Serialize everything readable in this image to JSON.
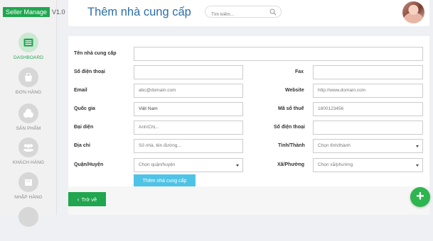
{
  "app": {
    "brand": "Seller Manage",
    "version": "V1.0"
  },
  "header": {
    "title": "Thêm nhà cung cấp",
    "search_placeholder": "Tìm kiếm..."
  },
  "sidebar": {
    "items": [
      {
        "label": "DASHBOARD",
        "icon": "dashboard-icon",
        "active": true
      },
      {
        "label": "ĐƠN HÀNG",
        "icon": "shopping-bag-icon",
        "active": false
      },
      {
        "label": "SẢN PHẨM",
        "icon": "products-icon",
        "active": false
      },
      {
        "label": "KHÁCH HÀNG",
        "icon": "users-icon",
        "active": false
      },
      {
        "label": "NHẬP HÀNG",
        "icon": "import-icon",
        "active": false
      }
    ]
  },
  "form": {
    "supplier_name": {
      "label": "Tên nhà cung cấp",
      "placeholder": ""
    },
    "phone": {
      "label": "Số điện thoại",
      "placeholder": ""
    },
    "fax": {
      "label": "Fax",
      "placeholder": ""
    },
    "email": {
      "label": "Email",
      "placeholder": "abc@domain.com"
    },
    "website": {
      "label": "Website",
      "placeholder": "http://www.domain.com"
    },
    "country": {
      "label": "Quốc gia",
      "value": "Việt Nam"
    },
    "tax_code": {
      "label": "Mã số thuế",
      "placeholder": "1800123456"
    },
    "representative": {
      "label": "Đại diện",
      "placeholder": "Anh/Chị..."
    },
    "rep_phone": {
      "label": "Số điện thoại",
      "placeholder": ""
    },
    "address": {
      "label": "Địa chỉ",
      "placeholder": "Số nhà, tên đường..."
    },
    "province": {
      "label": "Tỉnh/Thành",
      "value": "Chọn tỉnh/thành"
    },
    "district": {
      "label": "Quận/Huyện",
      "value": "Chọn quận/huyện"
    },
    "ward": {
      "label": "Xã/Phường",
      "value": "Chọn xã/phường"
    },
    "submit_label": "Thêm nhà cung cấp"
  },
  "footer": {
    "back_label": "Trở về"
  },
  "colors": {
    "brand_green": "#1fa64e",
    "title_blue": "#2c6fa8",
    "submit_blue": "#4fc3e6"
  }
}
